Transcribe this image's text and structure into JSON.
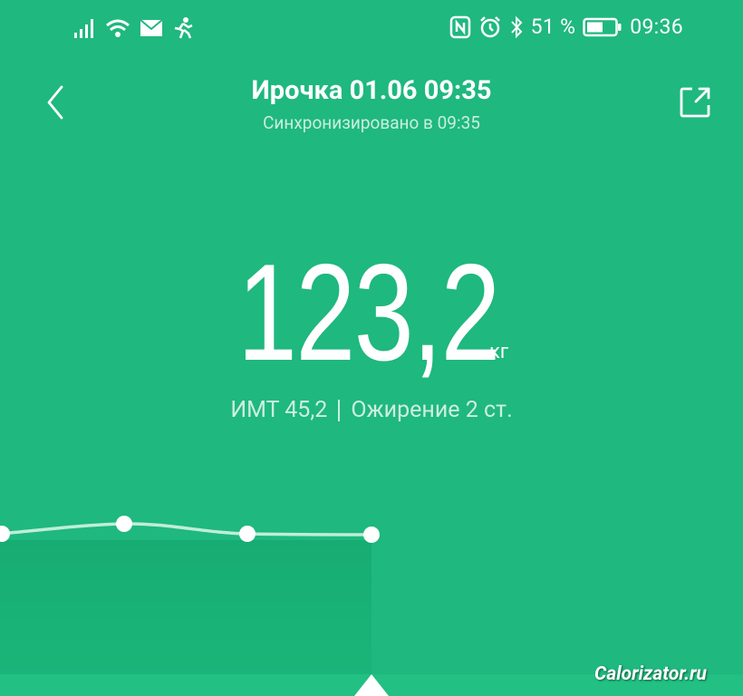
{
  "status_bar": {
    "battery_percent": "51 %",
    "time": "09:36",
    "icons": [
      "signal-icon",
      "wifi-icon",
      "mail-icon",
      "activity-icon",
      "nfc-icon",
      "alarm-icon",
      "bluetooth-icon",
      "battery-icon"
    ]
  },
  "header": {
    "title": "Ирочка 01.06 09:35",
    "sync_status": "Синхронизировано в 09:35"
  },
  "weight": {
    "value": "123,2",
    "unit": "кг"
  },
  "metrics": {
    "bmi": "ИМТ 45,2",
    "category": "Ожирение 2 ст."
  },
  "watermark": "Calorizator.ru",
  "colors": {
    "background": "#1fb87f",
    "text_secondary": "#cdeee0"
  }
}
